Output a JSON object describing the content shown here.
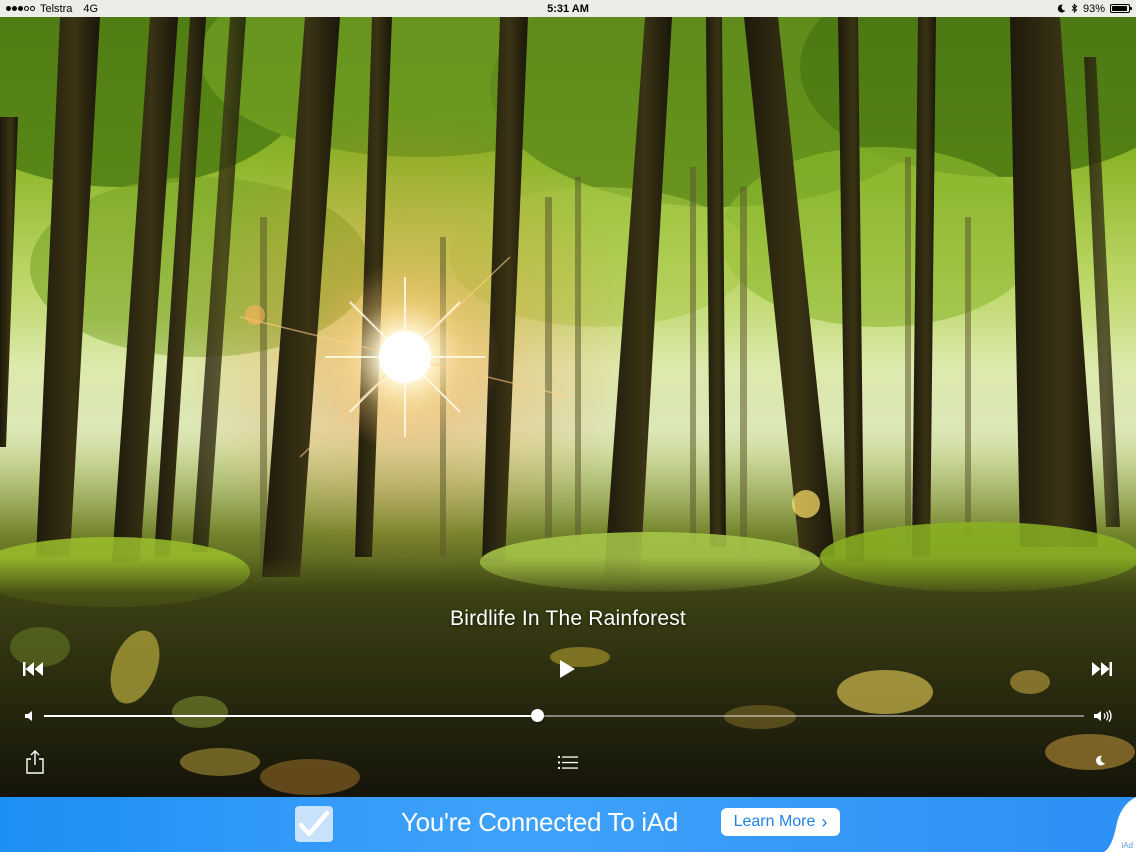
{
  "status_bar": {
    "carrier": "Telstra",
    "network": "4G",
    "time": "5:31 AM",
    "battery_percent": "93%",
    "battery_level": 0.93,
    "signal_bars_filled": 3,
    "signal_bars_total": 5,
    "icons": [
      "moon-icon",
      "bluetooth-icon",
      "battery-icon"
    ]
  },
  "player": {
    "track_title": "Birdlife In The Rainforest",
    "progress": 0.474,
    "icons": {
      "previous": "skip-back-icon",
      "play": "play-icon",
      "next": "skip-forward-icon",
      "volume_low": "volume-low-icon",
      "volume_high": "volume-high-icon",
      "share": "share-icon",
      "playlist": "list-icon",
      "sleep_timer": "moon-icon"
    }
  },
  "ad": {
    "headline": "You're Connected To iAd",
    "button_label": "Learn More",
    "button_chevron": "›",
    "corner_label": "iAd",
    "colors": {
      "background": "#2c94f5",
      "button_text": "#1f82e6"
    }
  }
}
